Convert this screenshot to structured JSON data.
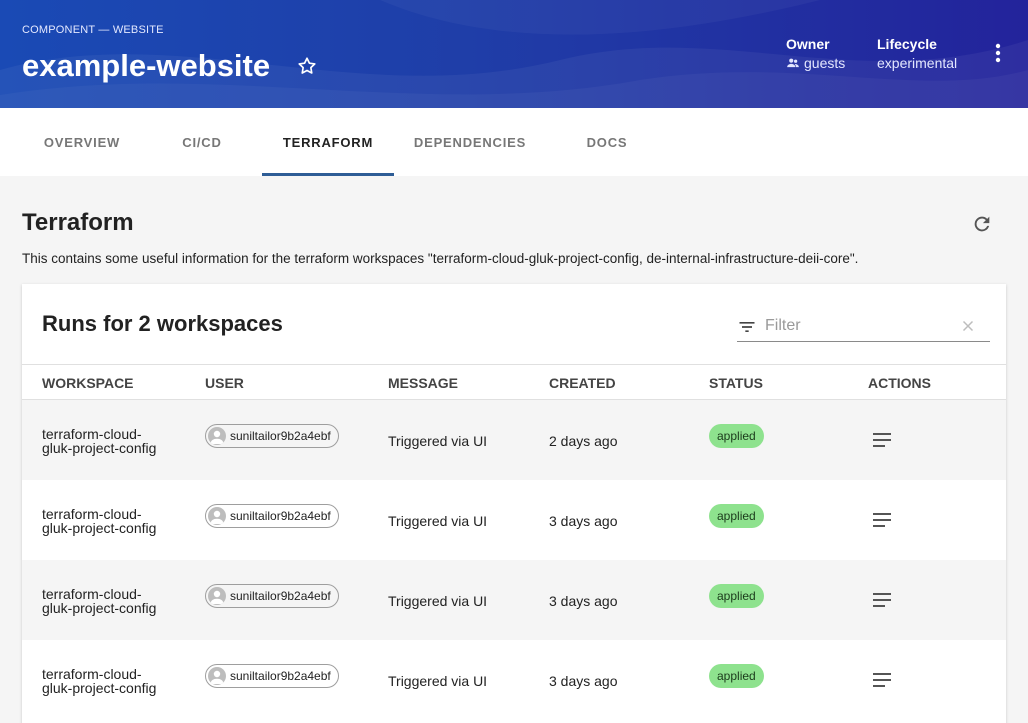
{
  "header": {
    "breadcrumb": "COMPONENT — WEBSITE",
    "title": "example-website",
    "owner_label": "Owner",
    "owner_value": "guests",
    "lifecycle_label": "Lifecycle",
    "lifecycle_value": "experimental"
  },
  "tabs": [
    {
      "label": "OVERVIEW",
      "active": false
    },
    {
      "label": "CI/CD",
      "active": false
    },
    {
      "label": "TERRAFORM",
      "active": true
    },
    {
      "label": "DEPENDENCIES",
      "active": false
    },
    {
      "label": "DOCS",
      "active": false
    }
  ],
  "section": {
    "title": "Terraform",
    "description": "This contains some useful information for the terraform workspaces \"terraform-cloud-gluk-project-config, de-internal-infrastructure-deii-core\"."
  },
  "card": {
    "title": "Runs for 2 workspaces",
    "filter_placeholder": "Filter",
    "columns": [
      "WORKSPACE",
      "USER",
      "MESSAGE",
      "CREATED",
      "STATUS",
      "ACTIONS"
    ],
    "rows": [
      {
        "workspace_line1": "terraform-cloud-",
        "workspace_line2": "gluk-project-config",
        "user": "suniltailor9b2a4ebf",
        "message": "Triggered via UI",
        "created": "2 days ago",
        "status": "applied"
      },
      {
        "workspace_line1": "terraform-cloud-",
        "workspace_line2": "gluk-project-config",
        "user": "suniltailor9b2a4ebf",
        "message": "Triggered via UI",
        "created": "3 days ago",
        "status": "applied"
      },
      {
        "workspace_line1": "terraform-cloud-",
        "workspace_line2": "gluk-project-config",
        "user": "suniltailor9b2a4ebf",
        "message": "Triggered via UI",
        "created": "3 days ago",
        "status": "applied"
      },
      {
        "workspace_line1": "terraform-cloud-",
        "workspace_line2": "gluk-project-config",
        "user": "suniltailor9b2a4ebf",
        "message": "Triggered via UI",
        "created": "3 days ago",
        "status": "applied"
      }
    ]
  },
  "icons": {
    "star": "star-outline-icon",
    "more": "more-vert-icon",
    "owner": "group-icon",
    "refresh": "refresh-icon",
    "filter": "filter-list-icon",
    "clear": "close-icon",
    "action": "notes-icon",
    "avatar": "person-icon"
  },
  "colors": {
    "header_start": "#1a4ab5",
    "header_end": "#23239b",
    "tab_indicator": "#2e5d96",
    "status_applied": "#8ee28e"
  }
}
